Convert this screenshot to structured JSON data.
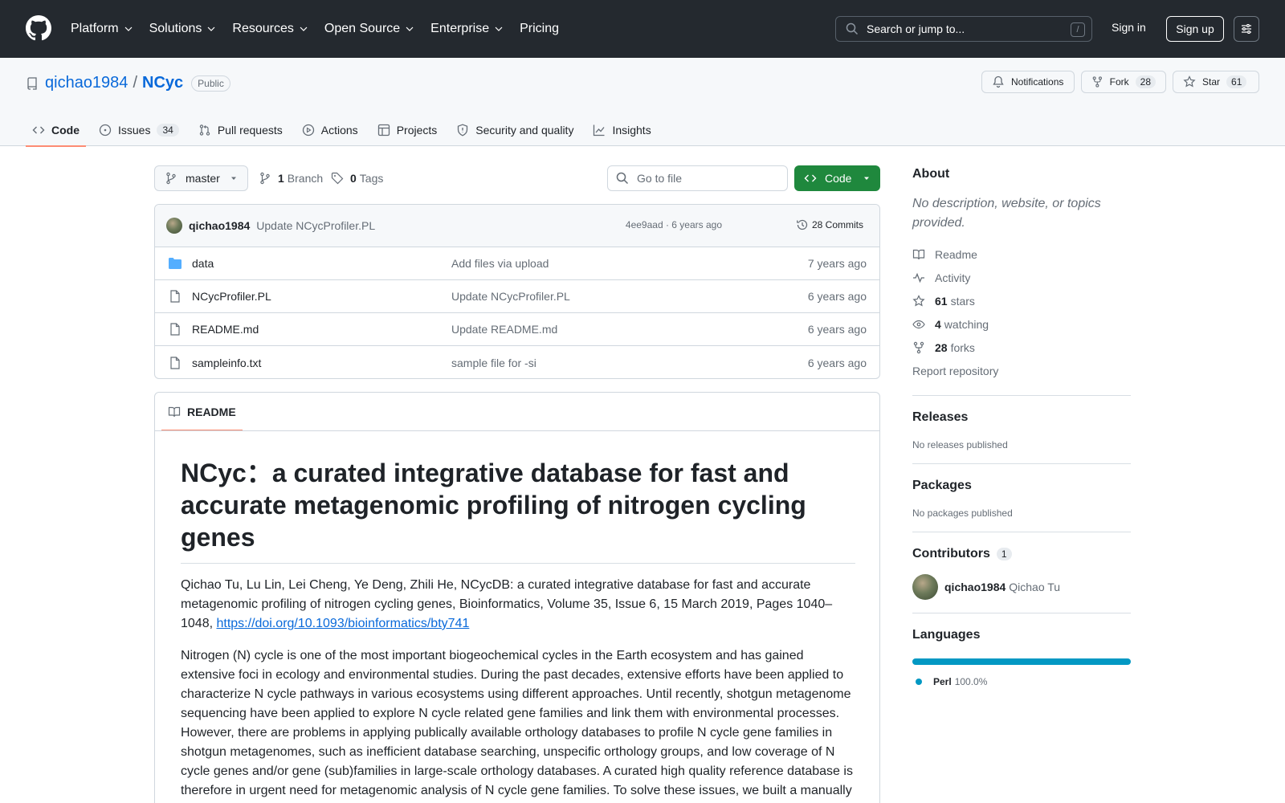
{
  "header": {
    "nav": [
      "Platform",
      "Solutions",
      "Resources",
      "Open Source",
      "Enterprise",
      "Pricing"
    ],
    "search_placeholder": "Search or jump to...",
    "search_shortcut": "/",
    "sign_in": "Sign in",
    "sign_up": "Sign up"
  },
  "repo": {
    "owner": "qichao1984",
    "separator": "/",
    "name": "NCyc",
    "visibility": "Public",
    "notifications_label": "Notifications",
    "fork_label": "Fork",
    "fork_count": "28",
    "star_label": "Star",
    "star_count": "61"
  },
  "tabs": [
    {
      "label": "Code",
      "icon": "code-icon",
      "count": ""
    },
    {
      "label": "Issues",
      "icon": "issue-icon",
      "count": "34"
    },
    {
      "label": "Pull requests",
      "icon": "pull-request-icon",
      "count": ""
    },
    {
      "label": "Actions",
      "icon": "play-icon",
      "count": ""
    },
    {
      "label": "Projects",
      "icon": "table-icon",
      "count": ""
    },
    {
      "label": "Security and quality",
      "icon": "shield-icon",
      "count": ""
    },
    {
      "label": "Insights",
      "icon": "graph-icon",
      "count": ""
    }
  ],
  "toolbar": {
    "branch": "master",
    "branch_count": "1",
    "branch_label": "Branch",
    "tag_count": "0",
    "tag_label": "Tags",
    "goto_placeholder": "Go to file",
    "code_button": "Code"
  },
  "latest_commit": {
    "author": "qichao1984",
    "message": "Update NCycProfiler.PL",
    "sha_time": "4ee9aad · 6 years ago",
    "commits": "28 Commits"
  },
  "files": [
    {
      "name": "data",
      "type": "folder",
      "message": "Add files via upload",
      "age": "7 years ago"
    },
    {
      "name": "NCycProfiler.PL",
      "type": "file",
      "message": "Update NCycProfiler.PL",
      "age": "6 years ago"
    },
    {
      "name": "README.md",
      "type": "file",
      "message": "Update README.md",
      "age": "6 years ago"
    },
    {
      "name": "sampleinfo.txt",
      "type": "file",
      "message": "sample file for -si",
      "age": "6 years ago"
    }
  ],
  "readme": {
    "tab_label": "README",
    "title": "NCyc：a curated integrative database for fast and accurate metagenomic profiling of nitrogen cycling genes",
    "citation": "Qichao Tu, Lu Lin, Lei Cheng, Ye Deng, Zhili He, NCycDB: a curated integrative database for fast and accurate metagenomic profiling of nitrogen cycling genes, Bioinformatics, Volume 35, Issue 6, 15 March 2019, Pages 1040–1048, ",
    "doi": "https://doi.org/10.1093/bioinformatics/bty741",
    "body": "Nitrogen (N) cycle is one of the most important biogeochemical cycles in the Earth ecosystem and has gained extensive foci in ecology and environmental studies. During the past decades, extensive efforts have been applied to characterize N cycle pathways in various ecosystems using different approaches. Until recently, shotgun metagenome sequencing have been applied to explore N cycle related gene families and link them with environmental processes. However, there are problems in applying publically available orthology databases to profile N cycle gene families in shotgun metagenomes, such as inefficient database searching, unspecific orthology groups, and low coverage of N cycle genes and/or gene (sub)families in large-scale orthology databases. A curated high quality reference database is therefore in urgent need for metagenomic analysis of N cycle gene families. To solve these issues, we built a manually"
  },
  "sidebar": {
    "about_title": "About",
    "about_desc": "No description, website, or topics provided.",
    "readme_link": "Readme",
    "activity_link": "Activity",
    "stars_count": "61",
    "stars_label": "stars",
    "watching_count": "4",
    "watching_label": "watching",
    "forks_count": "28",
    "forks_label": "forks",
    "report": "Report repository",
    "releases_title": "Releases",
    "releases_text": "No releases published",
    "packages_title": "Packages",
    "packages_text": "No packages published",
    "contributors_title": "Contributors",
    "contributors_count": "1",
    "contributor_login": "qichao1984",
    "contributor_name": "Qichao Tu",
    "languages_title": "Languages",
    "language_name": "Perl",
    "language_pct": "100.0%",
    "language_color": "#0298c3"
  }
}
